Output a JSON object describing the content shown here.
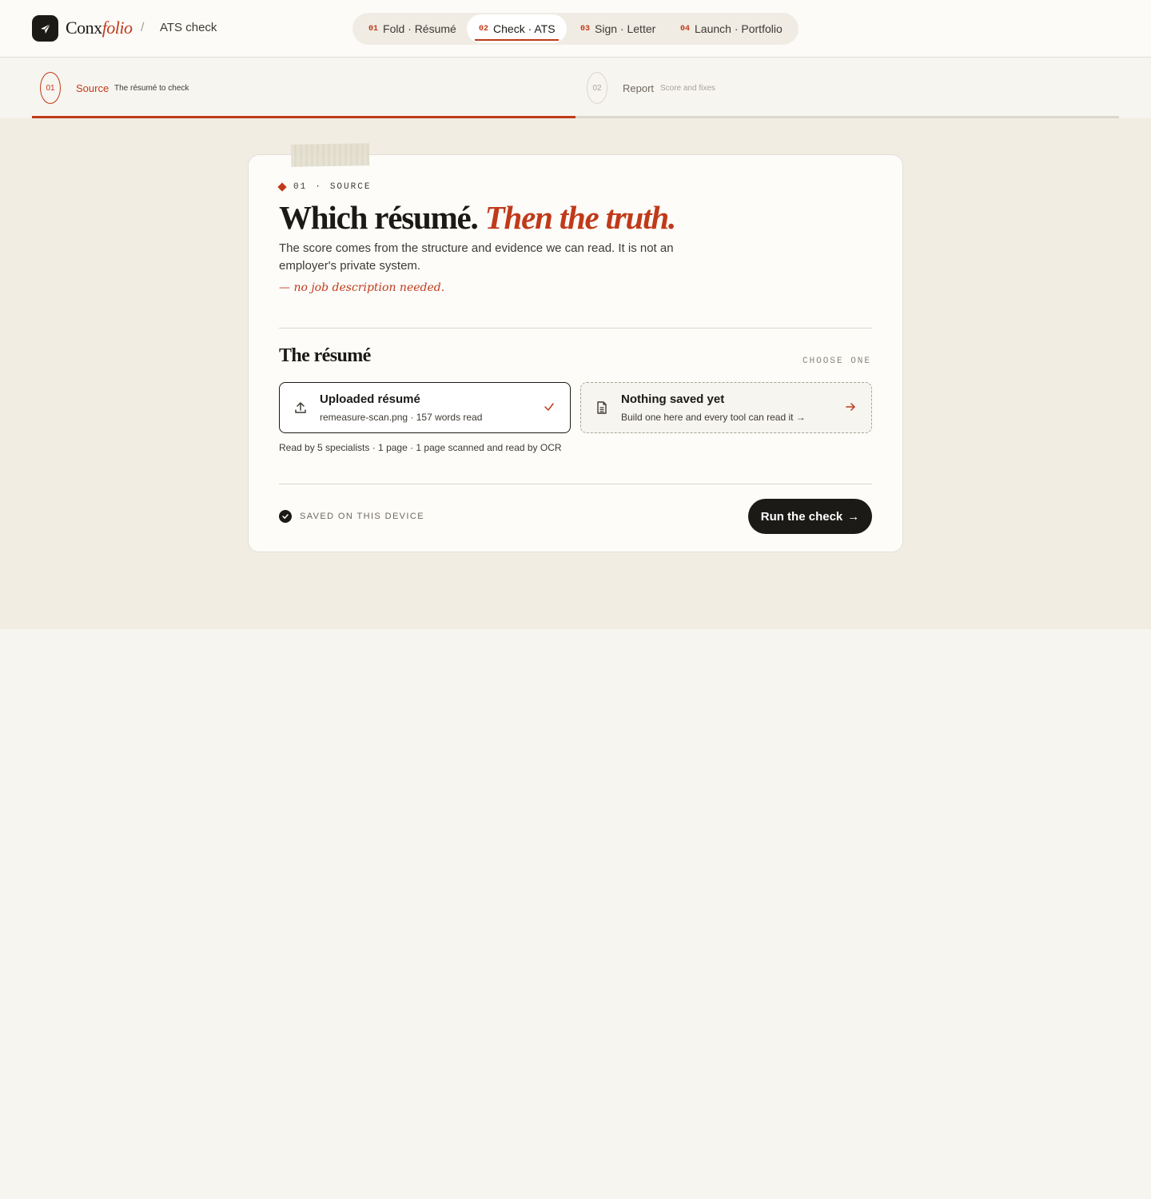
{
  "header": {
    "brand_main": "Conx",
    "brand_accent": "folio",
    "separator": "/",
    "page_title": "ATS check",
    "tabs": [
      {
        "num": "01",
        "label": "Fold · Résumé",
        "active": false
      },
      {
        "num": "02",
        "label": "Check · ATS",
        "active": true
      },
      {
        "num": "03",
        "label": "Sign · Letter",
        "active": false
      },
      {
        "num": "04",
        "label": "Launch · Portfolio",
        "active": false
      }
    ]
  },
  "stepper": {
    "steps": [
      {
        "num": "01",
        "label": "Source",
        "sub": "The résumé to check",
        "active": true
      },
      {
        "num": "02",
        "label": "Report",
        "sub": "Score and fixes",
        "active": false
      }
    ]
  },
  "card": {
    "eyebrow_num": "01",
    "eyebrow_dot": "·",
    "eyebrow_label": "SOURCE",
    "headline_main": "Which résumé.",
    "headline_accent": "Then the truth.",
    "lede": "The score comes from the structure and evidence we can read. It is not an employer's private system.",
    "note": "— no job description needed.",
    "section_title": "The résumé",
    "section_hint": "CHOOSE ONE",
    "options": [
      {
        "title": "Uploaded résumé",
        "sub": "remeasure-scan.png · 157 words read",
        "icon": "upload-icon",
        "mark": "check-icon",
        "selected": true
      },
      {
        "title": "Nothing saved yet",
        "sub": "Build one here and every tool can read it →",
        "icon": "document-icon",
        "mark": "arrow-right-icon",
        "selected": false
      }
    ],
    "meta": "Read by 5 specialists · 1 page · 1 page scanned and read by OCR",
    "saved_label": "SAVED ON THIS DEVICE",
    "run_button": "Run the check",
    "run_arrow": "→"
  },
  "colors": {
    "accent": "#c03a1a",
    "ink": "#1c1a17",
    "band": "#f1ede3",
    "page": "#f7f5f0"
  }
}
